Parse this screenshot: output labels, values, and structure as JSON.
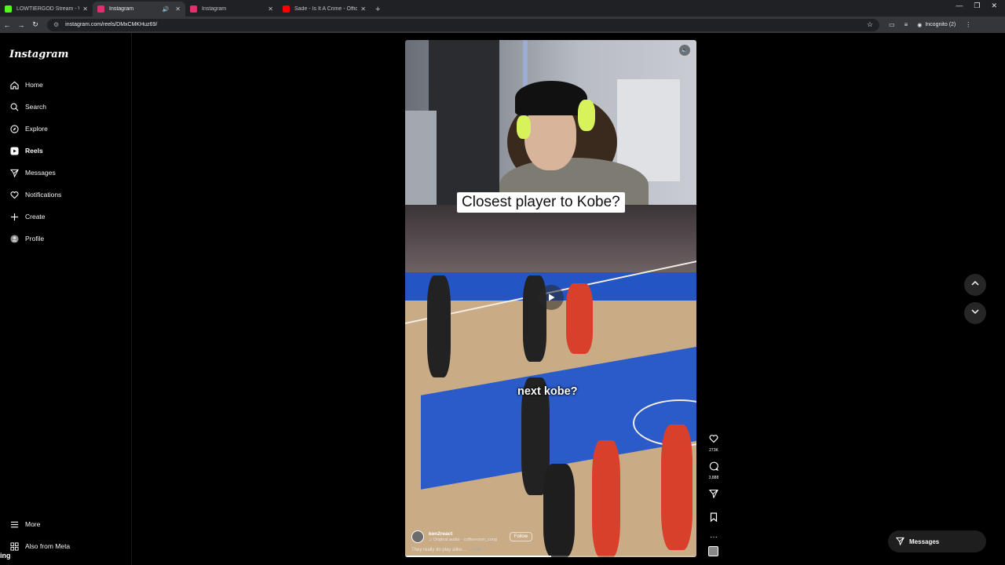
{
  "browser": {
    "tabs": [
      {
        "title": "LOWTIERGOD Stream - Watch",
        "favicon_color": "#53fc18",
        "active": false
      },
      {
        "title": "Instagram",
        "favicon_color": "#e1306c",
        "active": true
      },
      {
        "title": "Instagram",
        "favicon_color": "#e1306c",
        "active": false
      },
      {
        "title": "Sade - Is It A Crime - Official",
        "favicon_color": "#ff0000",
        "active": false
      }
    ],
    "url": "instagram.com/reels/DMxCMKHuz69/",
    "incognito_label": "Incognito (2)"
  },
  "sidebar": {
    "logo": "Instagram",
    "items": [
      {
        "label": "Home",
        "icon": "home-icon"
      },
      {
        "label": "Search",
        "icon": "search-icon"
      },
      {
        "label": "Explore",
        "icon": "compass-icon"
      },
      {
        "label": "Reels",
        "icon": "reels-icon"
      },
      {
        "label": "Messages",
        "icon": "paper-plane-icon"
      },
      {
        "label": "Notifications",
        "icon": "heart-icon"
      },
      {
        "label": "Create",
        "icon": "plus-icon"
      },
      {
        "label": "Profile",
        "icon": "avatar-icon"
      }
    ],
    "bottom": [
      {
        "label": "More",
        "icon": "menu-icon"
      },
      {
        "label": "Also from Meta",
        "icon": "meta-icon"
      }
    ]
  },
  "reel": {
    "caption_box": "Closest player to Kobe?",
    "overlay_text": "next kobe?",
    "author": "ken2react",
    "audio": "Original audio · coffeeroom_coog",
    "follow_label": "Follow",
    "description": "They really do play alike....",
    "more_label": "more",
    "progress": 0.5,
    "likes": "273K",
    "comments": "3,888"
  },
  "messages_pill": {
    "label": "Messages"
  },
  "edge_fragment": "ing"
}
